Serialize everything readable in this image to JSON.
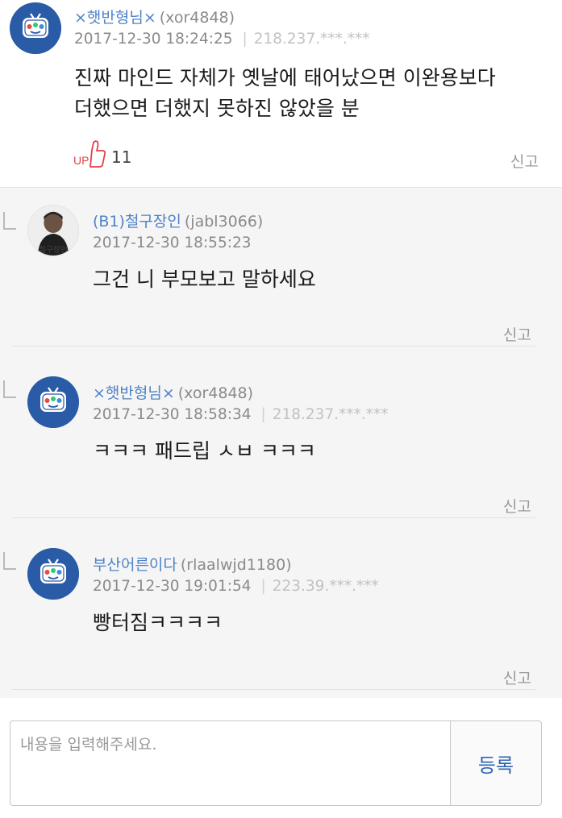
{
  "main_comment": {
    "nickname": "×햇반형님×",
    "user_id": "(xor4848)",
    "datetime": "2017-12-30 18:24:25",
    "ip": "218.237.***.***",
    "text_line1": "진짜 마인드 자체가 옛날에 태어났으면 이완용보다",
    "text_line2": "더했으면 더했지 못하진 않았을 분",
    "up_label": "UP",
    "up_count": "11",
    "report_label": "신고"
  },
  "replies": [
    {
      "nickname": "(B1)철구장인",
      "user_id": "(jabl3066)",
      "datetime": "2017-12-30 18:55:23",
      "ip": "",
      "text": "그건 니 부모보고 말하세요",
      "report_label": "신고",
      "avatar_caption": "철구장인"
    },
    {
      "nickname": "×햇반형님×",
      "user_id": "(xor4848)",
      "datetime": "2017-12-30 18:58:34",
      "ip": "218.237.***.***",
      "text": "ㅋㅋㅋ 패드립 ㅅㅂ ㅋㅋㅋ",
      "report_label": "신고"
    },
    {
      "nickname": "부산어른이다",
      "user_id": "(rlaalwjd1180)",
      "datetime": "2017-12-30 19:01:54",
      "ip": "223.39.***.***",
      "text": "빵터짐ㅋㅋㅋㅋ",
      "report_label": "신고"
    }
  ],
  "comment_input": {
    "placeholder": "내용을 입력해주세요.",
    "value": "",
    "submit_label": "등록"
  },
  "colors": {
    "nickname": "#4f83c8",
    "meta": "#8a8a8a",
    "up_icon": "#e0424a",
    "submit_text": "#2f65b4",
    "reply_background": "#f5f5f5",
    "tv_avatar": "#2a5ba6"
  },
  "icons": {
    "main_avatar": "tv-character-icon",
    "up_button": "thumbs-up-icon",
    "reply_indicator": "reply-arrow-icon"
  }
}
